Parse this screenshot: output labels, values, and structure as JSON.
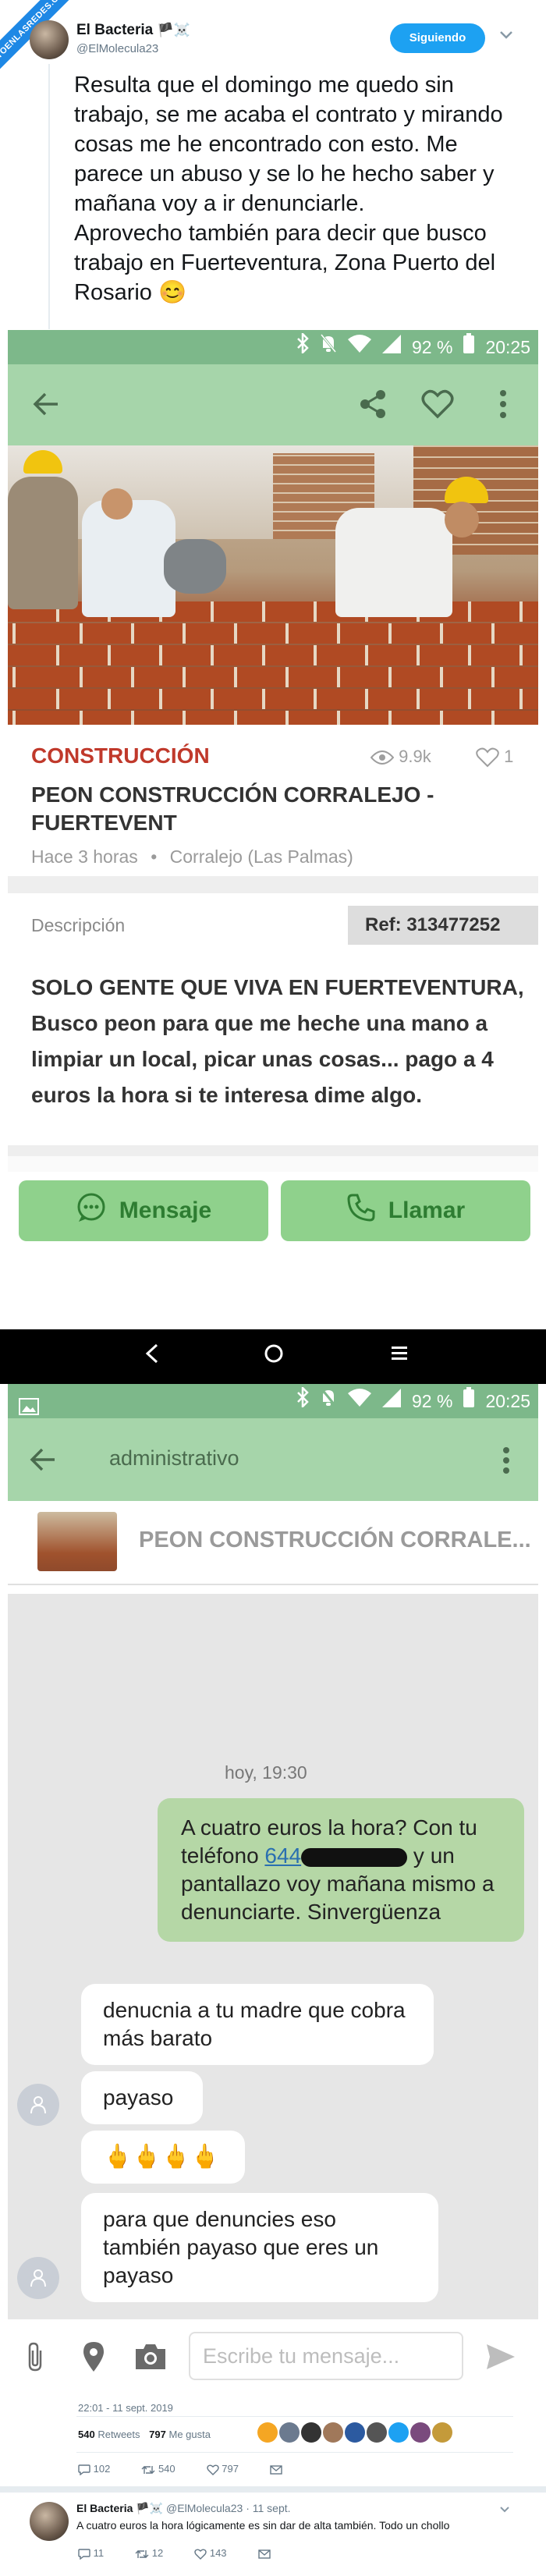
{
  "watermark": "VISTOENLASREDES.COM",
  "tweet": {
    "author_name": "El Bacteria",
    "author_flags": "🏴☠️",
    "handle": "@ElMolecula23",
    "follow_label": "Siguiendo",
    "text": "Resulta que el domingo me quedo sin trabajo, se me acaba el contrato y mirando cosas me he encontrado con esto. Me parece un abuso y se lo he hecho saber y mañana voy a ir denunciarle.\nAprovecho también para decir que busco trabajo en Fuerteventura, Zona Puerto del Rosario 😊"
  },
  "screen1": {
    "status": {
      "battery": "92 %",
      "time": "20:25"
    },
    "category": "CONSTRUCCIÓN",
    "views": "9.9k",
    "likes": "1",
    "title": "PEON CONSTRUCCIÓN CORRALEJO - FUERTEVENT",
    "meta_time": "Hace 3 horas",
    "meta_dot": "•",
    "meta_place": "Corralejo (Las Palmas)",
    "desc_label": "Descripción",
    "ref": "Ref: 313477252",
    "description": "SOLO GENTE QUE VIVA EN FUERTEVENTURA, Busco peon para que me heche una mano a limpiar un local, picar unas cosas... pago a 4 euros la hora si te interesa dime algo.",
    "btn_message": "Mensaje",
    "btn_call": "Llamar"
  },
  "screen2": {
    "status": {
      "battery": "92 %",
      "time": "20:25"
    },
    "appbar_title": "administrativo",
    "ad_title": "PEON CONSTRUCCIÓN CORRALE...",
    "day_label": "hoy, 19:30",
    "msg_out_before": "A cuatro euros la hora? Con tu teléfono ",
    "msg_out_phone": "644",
    "msg_out_after": " y un pantallazo voy mañana mismo a denunciarte. Sinvergüenza",
    "msg_in_1": "denucnia a tu madre que cobra más barato",
    "msg_in_2": "payaso",
    "msg_in_3": "🖕🖕🖕🖕",
    "msg_in_4": "para que denuncies eso también payaso que eres un payaso",
    "compose_placeholder": "Escribe tu mensaje..."
  },
  "footer": {
    "timestamp": "22:01 - 11 sept. 2019",
    "retweets_count": "540",
    "retweets_label": "Retweets",
    "likes_count": "797",
    "likes_label": "Me gusta",
    "reply_count": "102",
    "rt_count": "540",
    "heart_count": "797"
  },
  "reply": {
    "author_name": "El Bacteria",
    "author_flags": "🏴☠️",
    "handle": "@ElMolecula23",
    "date": "· 11 sept.",
    "text": "A cuatro euros la hora lógicamente es sin dar de alta también. Todo un chollo",
    "reply_count": "11",
    "rt_count": "12",
    "heart_count": "143"
  },
  "colors": {
    "status_green": "#7db88a",
    "appbar_green": "#a6d5aa",
    "button_green": "#8fd18c",
    "bubble_green": "#b5d7a6",
    "category_red": "#c0392b",
    "twitter_blue": "#1da1f2"
  }
}
